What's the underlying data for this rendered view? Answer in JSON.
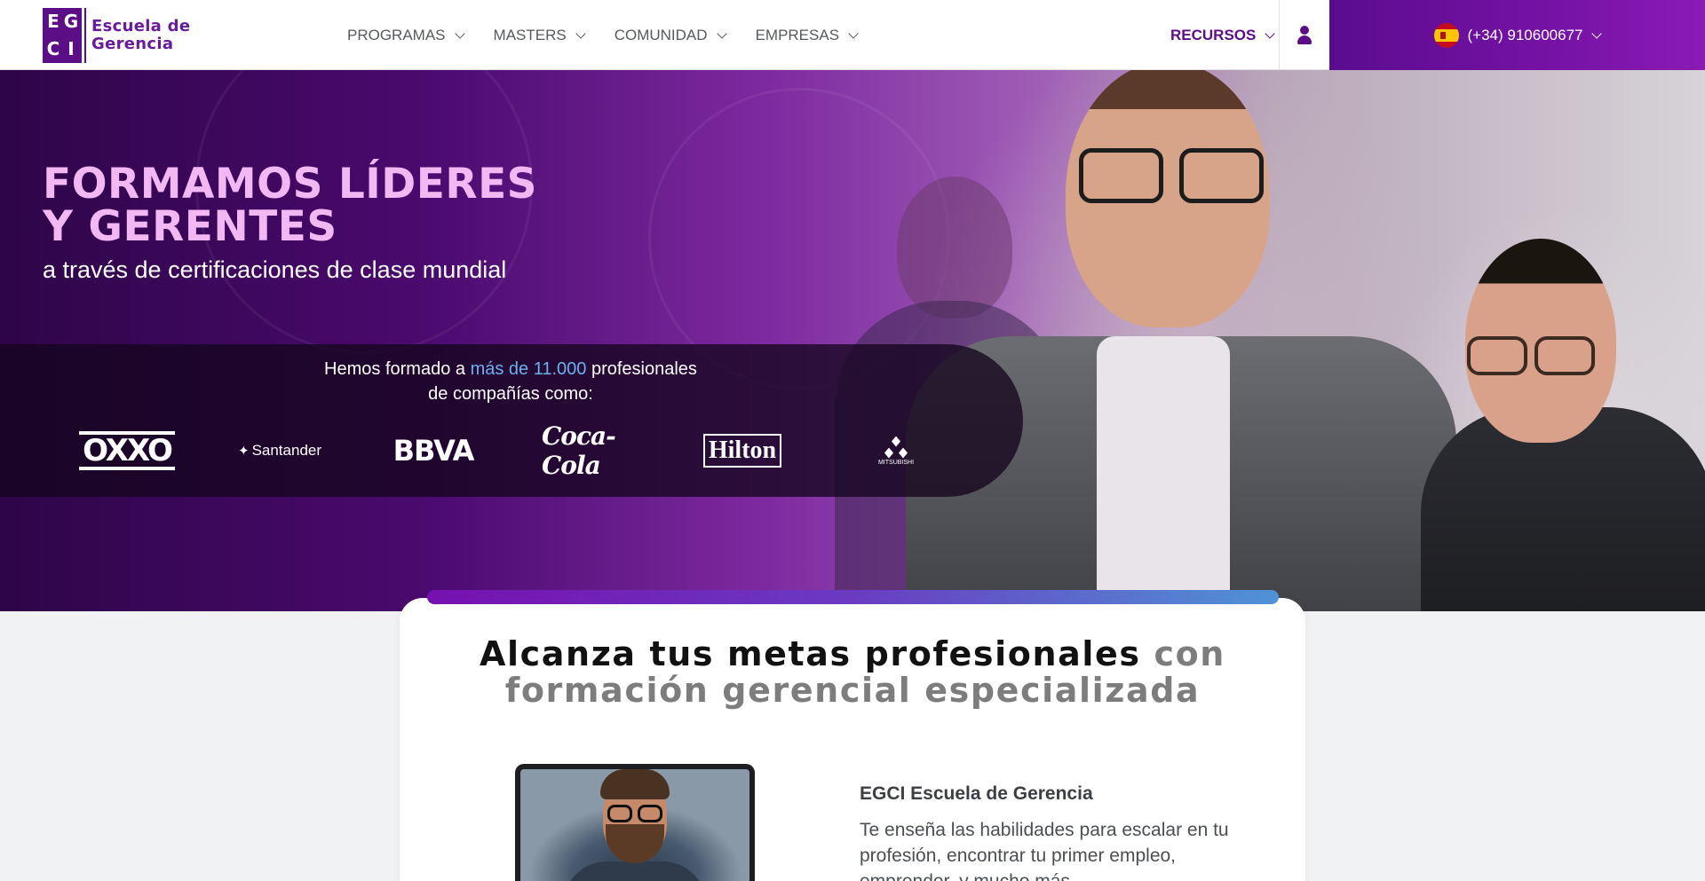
{
  "header": {
    "logo": {
      "letters": [
        "E",
        "G",
        "C",
        "I"
      ],
      "line1": "Escuela de",
      "line2": "Gerencia"
    },
    "nav": [
      {
        "label": "PROGRAMAS"
      },
      {
        "label": "MASTERS"
      },
      {
        "label": "COMUNIDAD"
      },
      {
        "label": "EMPRESAS"
      }
    ],
    "recursos_label": "RECURSOS",
    "phone": "(+34) 910600677",
    "colors": {
      "brand": "#5c0e86",
      "accent": "#7612a6"
    }
  },
  "hero": {
    "title_line1": "FORMAMOS LÍDERES",
    "title_line2": "Y GERENTES",
    "subtitle": "a través de certificaciones de clase mundial",
    "companies": {
      "text_before": "Hemos formado a ",
      "highlight": "más de 11.000",
      "text_after": " profesionales",
      "line2": "de compañías como:",
      "logos": [
        "OXXO",
        "Santander",
        "BBVA",
        "Coca-Cola",
        "Hilton",
        "MITSUBISHI"
      ]
    }
  },
  "card": {
    "title_dark": "Alcanza tus metas profesionales",
    "title_grey_1": "con",
    "title_grey_2": "formación gerencial especializada",
    "about_title": "EGCI Escuela de Gerencia",
    "about_text": "Te enseña las habilidades para escalar en tu profesión, encontrar tu primer empleo, emprender, y mucho más."
  }
}
